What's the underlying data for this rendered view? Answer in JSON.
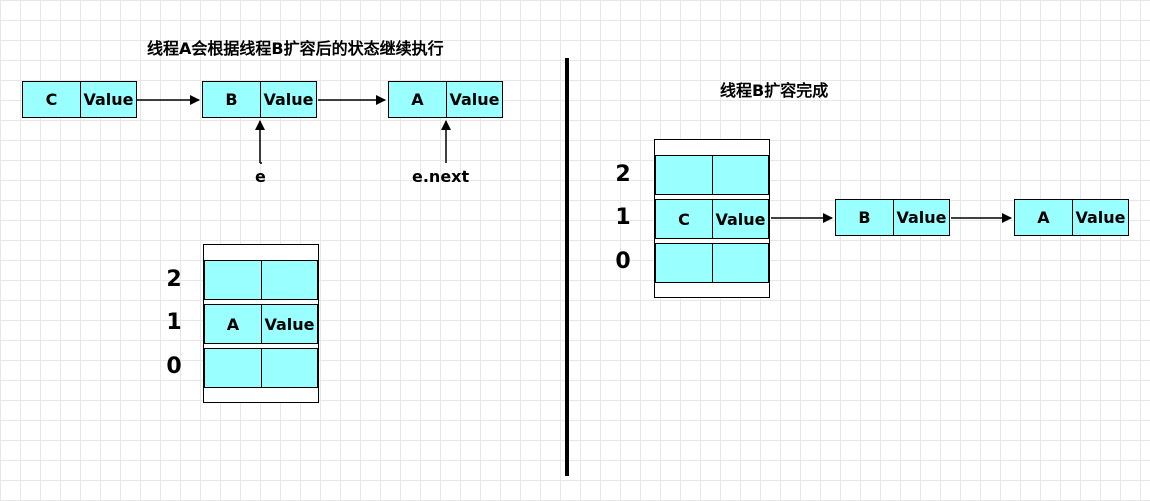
{
  "left_panel": {
    "title": "线程A会根据线程B扩容后的状态继续执行",
    "chain": [
      {
        "key": "C",
        "value": "Value"
      },
      {
        "key": "B",
        "value": "Value"
      },
      {
        "key": "A",
        "value": "Value"
      }
    ],
    "pointers": {
      "e": "e",
      "e_next": "e.next"
    },
    "table": {
      "indices": [
        "2",
        "1",
        "0"
      ],
      "slot1": {
        "key": "A",
        "value": "Value"
      }
    }
  },
  "right_panel": {
    "title": "线程B扩容完成",
    "table": {
      "indices": [
        "2",
        "1",
        "0"
      ],
      "slot1": {
        "key": "C",
        "value": "Value"
      }
    },
    "chain": [
      {
        "key": "B",
        "value": "Value"
      },
      {
        "key": "A",
        "value": "Value"
      }
    ]
  },
  "colors": {
    "node_fill": "#99ffff",
    "stroke": "#000000",
    "grid": "#e6e6e6"
  }
}
